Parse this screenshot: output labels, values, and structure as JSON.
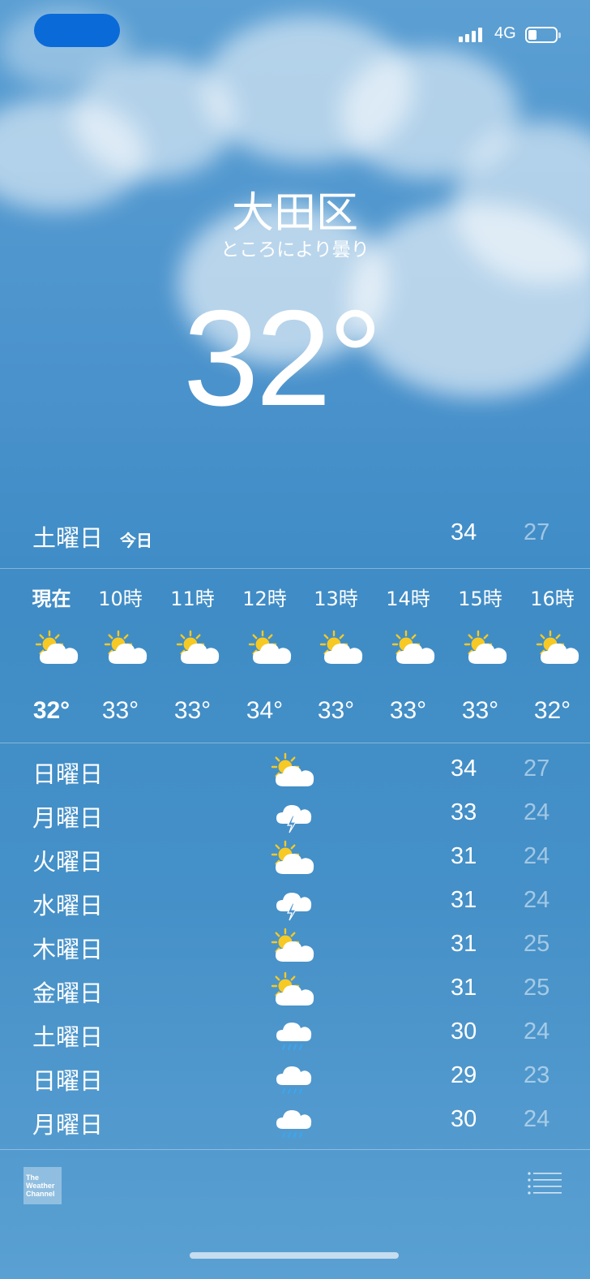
{
  "status_bar": {
    "network": "4G",
    "battery_level": 0.3
  },
  "header": {
    "city": "大田区",
    "condition": "ところにより曇り",
    "temperature": "32°"
  },
  "today": {
    "day": "土曜日",
    "tag": "今日",
    "high": "34",
    "low": "27"
  },
  "hourly": [
    {
      "time": "現在",
      "temp": "32°",
      "icon": "partly-cloudy-icon"
    },
    {
      "time": "10時",
      "temp": "33°",
      "icon": "partly-cloudy-icon"
    },
    {
      "time": "11時",
      "temp": "33°",
      "icon": "partly-cloudy-icon"
    },
    {
      "time": "12時",
      "temp": "34°",
      "icon": "partly-cloudy-icon"
    },
    {
      "time": "13時",
      "temp": "33°",
      "icon": "partly-cloudy-icon"
    },
    {
      "time": "14時",
      "temp": "33°",
      "icon": "partly-cloudy-icon"
    },
    {
      "time": "15時",
      "temp": "33°",
      "icon": "partly-cloudy-icon"
    },
    {
      "time": "16時",
      "temp": "32°",
      "icon": "partly-cloudy-icon"
    }
  ],
  "daily": [
    {
      "day": "日曜日",
      "icon": "partly-cloudy-icon",
      "high": "34",
      "low": "27"
    },
    {
      "day": "月曜日",
      "icon": "thunderstorm-icon",
      "high": "33",
      "low": "24"
    },
    {
      "day": "火曜日",
      "icon": "partly-cloudy-icon",
      "high": "31",
      "low": "24"
    },
    {
      "day": "水曜日",
      "icon": "thunderstorm-icon",
      "high": "31",
      "low": "24"
    },
    {
      "day": "木曜日",
      "icon": "partly-cloudy-icon",
      "high": "31",
      "low": "25"
    },
    {
      "day": "金曜日",
      "icon": "partly-cloudy-icon",
      "high": "31",
      "low": "25"
    },
    {
      "day": "土曜日",
      "icon": "rain-icon",
      "high": "30",
      "low": "24"
    },
    {
      "day": "日曜日",
      "icon": "rain-icon",
      "high": "29",
      "low": "23"
    },
    {
      "day": "月曜日",
      "icon": "rain-icon",
      "high": "30",
      "low": "24"
    }
  ],
  "footer": {
    "logo_text": [
      "The",
      "Weather",
      "Channel"
    ]
  },
  "colors": {
    "sky": "#4a92cc",
    "pill": "#0a6ad8",
    "sun": "#f6c924",
    "rain": "#3aa7f0"
  }
}
